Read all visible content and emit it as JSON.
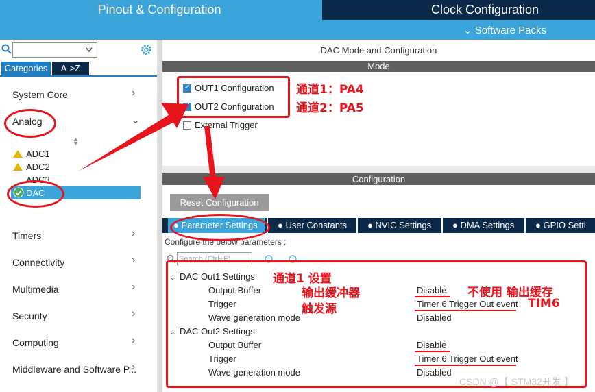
{
  "header": {
    "left_title": "Pinout & Configuration",
    "right_title": "Clock Configuration",
    "software_packs": "Software Packs"
  },
  "sidebar": {
    "tabs": [
      "Categories",
      "A->Z"
    ],
    "categories": [
      {
        "label": "System Core"
      },
      {
        "label": "Analog"
      },
      {
        "label": "Timers"
      },
      {
        "label": "Connectivity"
      },
      {
        "label": "Multimedia"
      },
      {
        "label": "Security"
      },
      {
        "label": "Computing"
      },
      {
        "label": "Middleware and Software P..."
      }
    ],
    "analog_items": [
      "ADC1",
      "ADC2",
      "ADC3",
      "DAC"
    ]
  },
  "main": {
    "title": "DAC Mode and Configuration",
    "mode_bar": "Mode",
    "mode_options": [
      {
        "label": "OUT1 Configuration",
        "checked": true
      },
      {
        "label": "OUT2 Configuration",
        "checked": true
      },
      {
        "label": "External Trigger",
        "checked": false
      }
    ],
    "config_bar": "Configuration",
    "reset_button": "Reset Configuration",
    "tabs": [
      "Parameter Settings",
      "User Constants",
      "NVIC Settings",
      "DMA Settings",
      "GPIO Setti"
    ],
    "hint": "Configure the below parameters :",
    "search_placeholder": "Search (Ctrl+F)",
    "groups": [
      {
        "title": "DAC Out1 Settings",
        "params": [
          {
            "name": "Output Buffer",
            "value": "Disable"
          },
          {
            "name": "Trigger",
            "value": "Timer 6 Trigger Out event"
          },
          {
            "name": "Wave generation mode",
            "value": "Disabled"
          }
        ]
      },
      {
        "title": "DAC Out2 Settings",
        "params": [
          {
            "name": "Output Buffer",
            "value": "Disable"
          },
          {
            "name": "Trigger",
            "value": "Timer 6 Trigger Out event"
          },
          {
            "name": "Wave generation mode",
            "value": "Disabled"
          }
        ]
      }
    ]
  },
  "annotations": {
    "ch1": "通道1：PA4",
    "ch2": "通道2：PA5",
    "ch1_settings": "通道1 设置",
    "output_buffer": "输出缓冲器",
    "trigger_source": "触发源",
    "no_buffer": "不使用 输出缓存",
    "tim6": "TIM6",
    "color": "#e8141c"
  },
  "watermark": "CSDN @【 STM32开发 】",
  "colors": {
    "header_blue": "#3ba4da",
    "header_dark": "#0b2a4a",
    "annotation_red": "#e8141c"
  }
}
